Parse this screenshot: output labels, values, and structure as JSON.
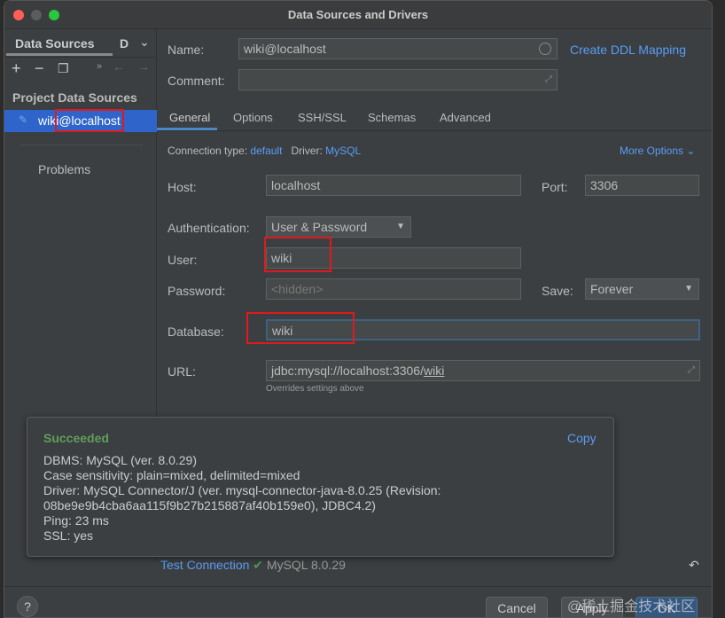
{
  "window": {
    "title": "Data Sources and Drivers"
  },
  "sidebar": {
    "tab_active": "Data Sources",
    "tab_other": "D",
    "section": "Project Data Sources",
    "item": "wiki@localhost",
    "problems": "Problems"
  },
  "form": {
    "name_label": "Name:",
    "name_value": "wiki@localhost",
    "ddl_link": "Create DDL Mapping",
    "comment_label": "Comment:",
    "comment_value": "",
    "tabs": [
      "General",
      "Options",
      "SSH/SSL",
      "Schemas",
      "Advanced"
    ],
    "conn_type_label": "Connection type:",
    "conn_type_value": "default",
    "driver_label": "Driver:",
    "driver_value": "MySQL",
    "more_options": "More Options",
    "host_label": "Host:",
    "host_value": "localhost",
    "port_label": "Port:",
    "port_value": "3306",
    "auth_label": "Authentication:",
    "auth_value": "User & Password",
    "user_label": "User:",
    "user_value": "wiki",
    "password_label": "Password:",
    "password_placeholder": "<hidden>",
    "save_label": "Save:",
    "save_value": "Forever",
    "database_label": "Database:",
    "database_value": "wiki",
    "url_label": "URL:",
    "url_value_prefix": "jdbc:mysql://localhost:3306/",
    "url_value_db": "wiki",
    "url_hint": "Overrides settings above"
  },
  "popup": {
    "status": "Succeeded",
    "copy": "Copy",
    "lines": [
      "DBMS: MySQL (ver. 8.0.29)",
      "Case sensitivity: plain=mixed, delimited=mixed",
      "Driver: MySQL Connector/J (ver. mysql-connector-java-8.0.25 (Revision:",
      "08be9e9b4cba6aa115f9b27b215887af40b159e0), JDBC4.2)",
      "Ping: 23 ms",
      "SSL: yes"
    ]
  },
  "footer": {
    "test_connection": "Test Connection",
    "test_result": "MySQL 8.0.29",
    "help": "?",
    "cancel": "Cancel",
    "apply": "Apply",
    "ok": "OK",
    "watermark": "@稀土掘金技术社区"
  },
  "colors": {
    "accent": "#589df6",
    "success": "#499c54",
    "selection": "#2f65ca",
    "highlight": "#e0191d"
  }
}
